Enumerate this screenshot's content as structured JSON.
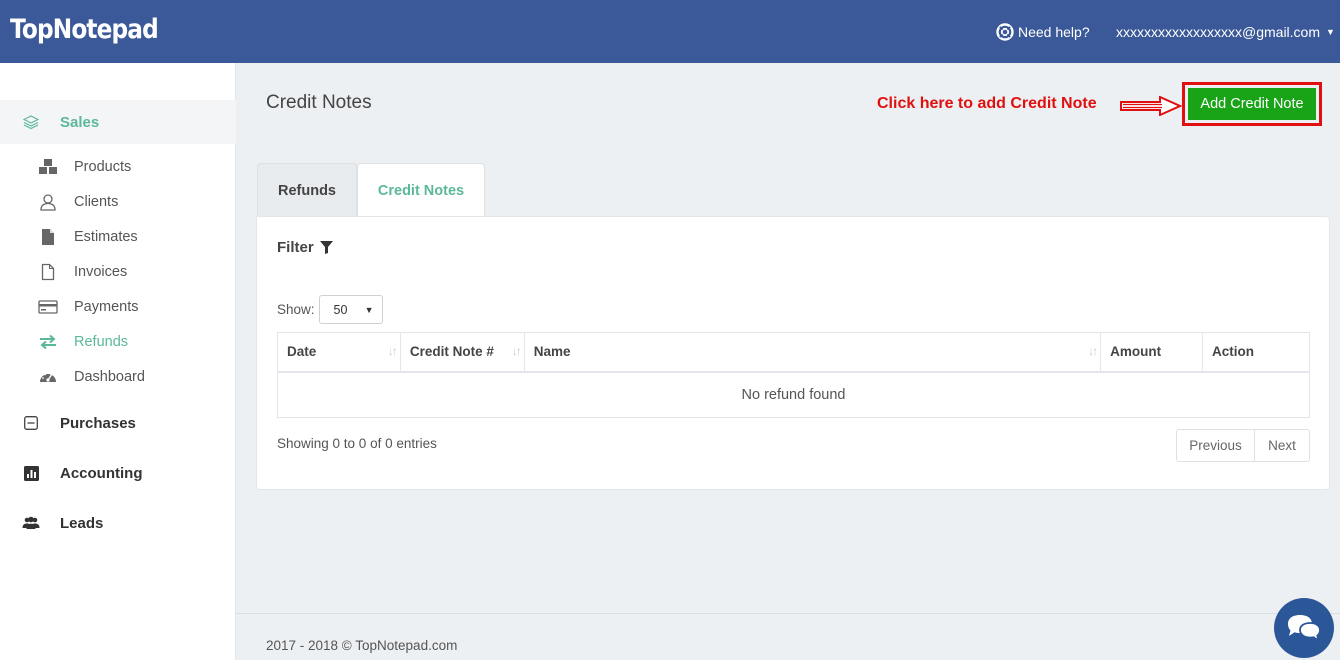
{
  "header": {
    "logo": "TopNotepad",
    "help_label": "Need help?",
    "user_email": "xxxxxxxxxxxxxxxxxx@gmail.com"
  },
  "sidebar": {
    "sales": "Sales",
    "sub_items": [
      "Products",
      "Clients",
      "Estimates",
      "Invoices",
      "Payments",
      "Refunds",
      "Dashboard"
    ],
    "purchases": "Purchases",
    "accounting": "Accounting",
    "leads": "Leads"
  },
  "main": {
    "title": "Credit Notes",
    "callout": "Click here to add Credit Note",
    "add_button": "Add Credit Note",
    "tabs": [
      "Refunds",
      "Credit Notes"
    ],
    "filter_label": "Filter",
    "show_label": "Show:",
    "show_value": "50",
    "table": {
      "columns": [
        "Date",
        "Credit Note #",
        "Name",
        "Amount",
        "Action"
      ],
      "empty_message": "No refund found"
    },
    "info": "Showing 0 to 0 of 0 entries",
    "pager": {
      "previous": "Previous",
      "next": "Next"
    }
  },
  "footer": {
    "text": "2017 - 2018 © TopNotepad.com"
  },
  "colors": {
    "header": "#3b5998",
    "accent": "#5bb89a",
    "add_button": "#19a317",
    "callout": "#e01010"
  }
}
